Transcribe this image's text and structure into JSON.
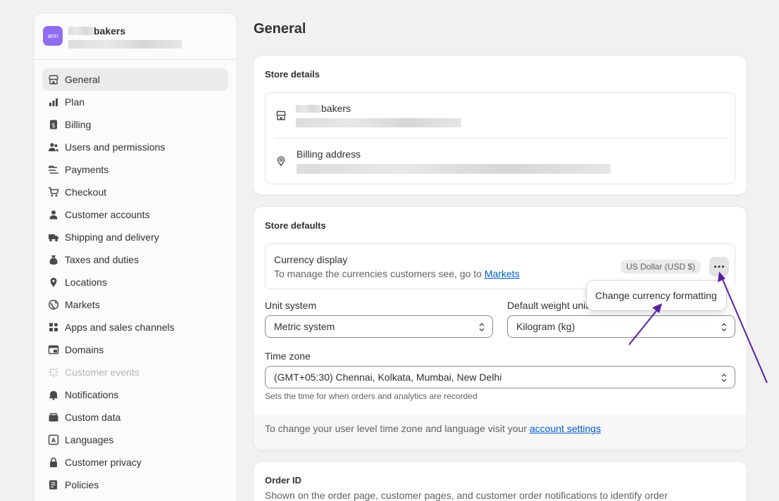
{
  "sidebar": {
    "store_avatar": "ann",
    "store_name": "bakers",
    "items": [
      {
        "label": "General",
        "icon": "store-icon",
        "active": true
      },
      {
        "label": "Plan",
        "icon": "chart-icon"
      },
      {
        "label": "Billing",
        "icon": "dollar-icon"
      },
      {
        "label": "Users and permissions",
        "icon": "users-icon"
      },
      {
        "label": "Payments",
        "icon": "payment-icon"
      },
      {
        "label": "Checkout",
        "icon": "cart-icon"
      },
      {
        "label": "Customer accounts",
        "icon": "person-icon"
      },
      {
        "label": "Shipping and delivery",
        "icon": "truck-icon"
      },
      {
        "label": "Taxes and duties",
        "icon": "tax-bag-icon"
      },
      {
        "label": "Locations",
        "icon": "location-icon"
      },
      {
        "label": "Markets",
        "icon": "globe-icon"
      },
      {
        "label": "Apps and sales channels",
        "icon": "apps-icon"
      },
      {
        "label": "Domains",
        "icon": "domain-icon"
      },
      {
        "label": "Customer events",
        "icon": "events-icon",
        "disabled": true
      },
      {
        "label": "Notifications",
        "icon": "bell-icon"
      },
      {
        "label": "Custom data",
        "icon": "database-icon"
      },
      {
        "label": "Languages",
        "icon": "language-icon"
      },
      {
        "label": "Customer privacy",
        "icon": "lock-icon"
      },
      {
        "label": "Policies",
        "icon": "policy-icon"
      }
    ]
  },
  "main": {
    "page_title": "General",
    "store_details": {
      "title": "Store details",
      "store_name": "bakers",
      "billing_label": "Billing address"
    },
    "store_defaults": {
      "title": "Store defaults",
      "currency_title": "Currency display",
      "currency_desc": "To manage the currencies customers see, go to",
      "currency_link": "Markets",
      "currency_badge": "US Dollar (USD $)",
      "popover_item": "Change currency formatting",
      "unit_system_label": "Unit system",
      "unit_system_value": "Metric system",
      "weight_label": "Default weight unit",
      "weight_value": "Kilogram (kg)",
      "timezone_label": "Time zone",
      "timezone_value": "(GMT+05:30) Chennai, Kolkata, Mumbai, New Delhi",
      "timezone_help": "Sets the time for when orders and analytics are recorded",
      "footer_text": "To change your user level time zone and language visit your",
      "footer_link": "account settings"
    },
    "order_id": {
      "title": "Order ID",
      "desc": "Shown on the order page, customer pages, and customer order notifications to identify order"
    }
  },
  "annotation_color": "#5b1fa6"
}
